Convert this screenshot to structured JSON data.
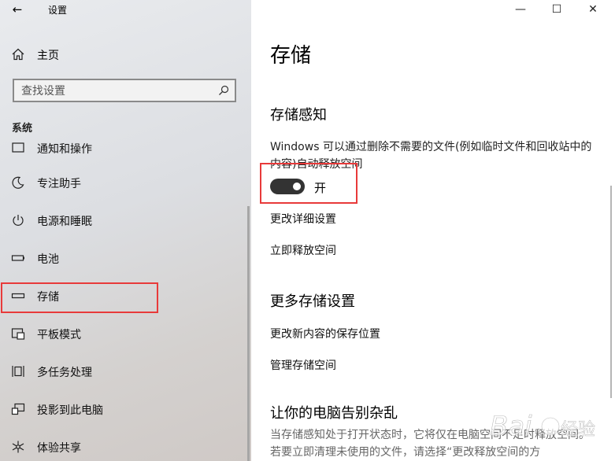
{
  "window": {
    "title": "设置",
    "back_glyph": "←",
    "minimize_glyph": "—",
    "maximize_glyph": "☐",
    "close_glyph": "✕"
  },
  "sidebar": {
    "home_label": "主页",
    "search_placeholder": "查找设置",
    "section_header": "系统",
    "items": [
      {
        "label": "通知和操作",
        "icon": "notification-icon"
      },
      {
        "label": "专注助手",
        "icon": "moon-icon"
      },
      {
        "label": "电源和睡眠",
        "icon": "power-icon"
      },
      {
        "label": "电池",
        "icon": "battery-icon"
      },
      {
        "label": "存储",
        "icon": "storage-icon",
        "selected": true
      },
      {
        "label": "平板模式",
        "icon": "tablet-mode-icon"
      },
      {
        "label": "多任务处理",
        "icon": "multitasking-icon"
      },
      {
        "label": "投影到此电脑",
        "icon": "projecting-icon"
      },
      {
        "label": "体验共享",
        "icon": "share-icon"
      }
    ]
  },
  "content": {
    "title": "存储",
    "storage_sense_header": "存储感知",
    "storage_sense_desc": "Windows 可以通过删除不需要的文件(例如临时文件和回收站中的内容)自动释放空间",
    "toggle": {
      "state": "on",
      "label": "开"
    },
    "link_change_settings": "更改详细设置",
    "link_free_space": "立即释放空间",
    "more_settings_header": "更多存储设置",
    "link_change_save_location": "更改新内容的保存位置",
    "link_manage_spaces": "管理存储空间",
    "declutter_header": "让你的电脑告别杂乱",
    "declutter_desc": "当存储感知处于打开状态时，它将仅在电脑空间不足时释放空间。 若要立即清理未使用的文件，请选择“更改释放空间的方"
  },
  "colors": {
    "highlight": "#e83a3a",
    "toggle_on": "#333333"
  },
  "watermark": {
    "text": "经验"
  }
}
